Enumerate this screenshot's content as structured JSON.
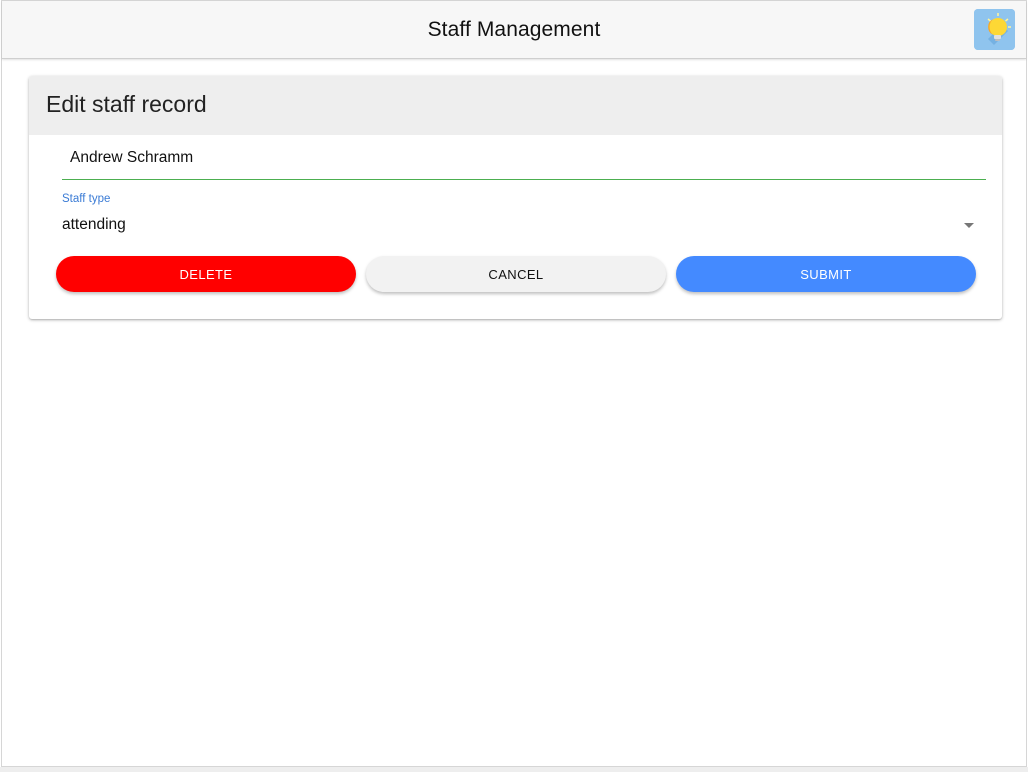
{
  "header": {
    "title": "Staff Management",
    "theme_toggle_icon": "lightbulb-icon"
  },
  "card": {
    "title": "Edit staff record",
    "name_field": {
      "value": "Andrew Schramm"
    },
    "staff_type": {
      "label": "Staff type",
      "selected": "attending"
    },
    "buttons": {
      "delete": "DELETE",
      "cancel": "CANCEL",
      "submit": "SUBMIT"
    }
  },
  "colors": {
    "delete": "#ff0000",
    "submit": "#448aff",
    "focus_underline": "#4caf50",
    "select_label": "#3a7bd5"
  }
}
